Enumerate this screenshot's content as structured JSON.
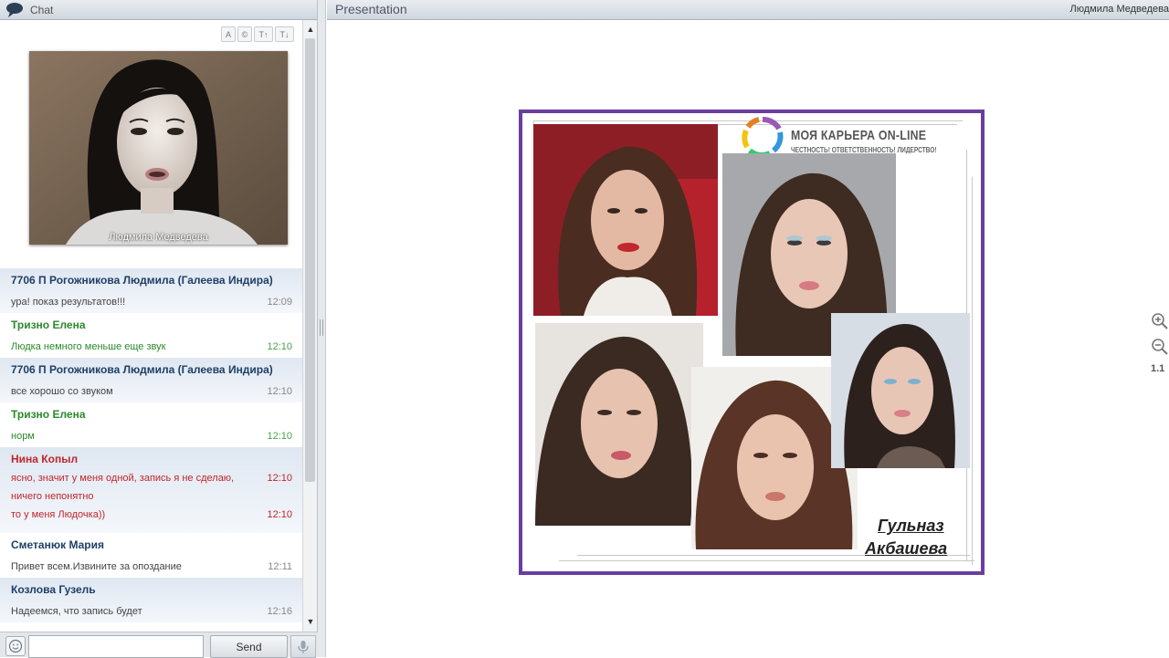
{
  "chat": {
    "title": "Chat",
    "toolbar": [
      "A",
      "©",
      "T↑",
      "T↓"
    ],
    "webcam_name": "Людмила Медведева",
    "messages": [
      {
        "author": "7706 П Рогожникова Людмила (Галеева Индира)",
        "style": "navy",
        "bg": "blue",
        "lines": [
          {
            "text": "ура! показ результатов!!!",
            "time": "12:09"
          }
        ]
      },
      {
        "author": "Тризно Елена",
        "style": "green",
        "bg": "white",
        "lines": [
          {
            "text": "Людка немного меньше еще звук",
            "time": "12:10"
          }
        ]
      },
      {
        "author": "7706 П Рогожникова Людмила (Галеева Индира)",
        "style": "navy",
        "bg": "blue",
        "lines": [
          {
            "text": "все хорошо со звуком",
            "time": "12:10"
          }
        ]
      },
      {
        "author": "Тризно Елена",
        "style": "green",
        "bg": "white",
        "lines": [
          {
            "text": "норм",
            "time": "12:10"
          }
        ]
      },
      {
        "author": "Нина Копыл",
        "style": "red",
        "bg": "blue",
        "lines": [
          {
            "text": "ясно, значит у меня одной, запись я не сделаю,",
            "time": "12:10"
          },
          {
            "text": "ничего непонятно",
            "time": ""
          },
          {
            "text": "то у меня Людочка))",
            "time": "12:10"
          }
        ]
      },
      {
        "author": "Сметанюк Мария",
        "style": "navy",
        "bg": "white",
        "lines": [
          {
            "text": "Привет всем.Извините за опоздание",
            "time": "12:11"
          }
        ]
      },
      {
        "author": "Козлова Гузель",
        "style": "navy",
        "bg": "blue",
        "lines": [
          {
            "text": "Надеемся, что запись будет",
            "time": "12:16"
          }
        ]
      }
    ],
    "input_value": "",
    "send_label": "Send"
  },
  "presentation": {
    "title": "Presentation",
    "presenter": "Людмила Медведева",
    "brand_name": "МОЯ КАРЬЕРА ON-LINE",
    "brand_slogan": "ЧЕСТНОСТЬ! ОТВЕТСТВЕННОСТЬ! ЛИДЕРСТВО!",
    "caption_line1": "Гульназ",
    "caption_line2": "Акбашева",
    "zoom_level": "1.1"
  },
  "colors": {
    "slide_border": "#6a3ea0",
    "author_navy": "#1f3f66",
    "author_green": "#2a8a2a",
    "author_red": "#c0262c"
  },
  "icons": [
    "chat-bubble-icon",
    "emoji-icon",
    "microphone-icon",
    "zoom-in-icon",
    "zoom-out-icon"
  ]
}
